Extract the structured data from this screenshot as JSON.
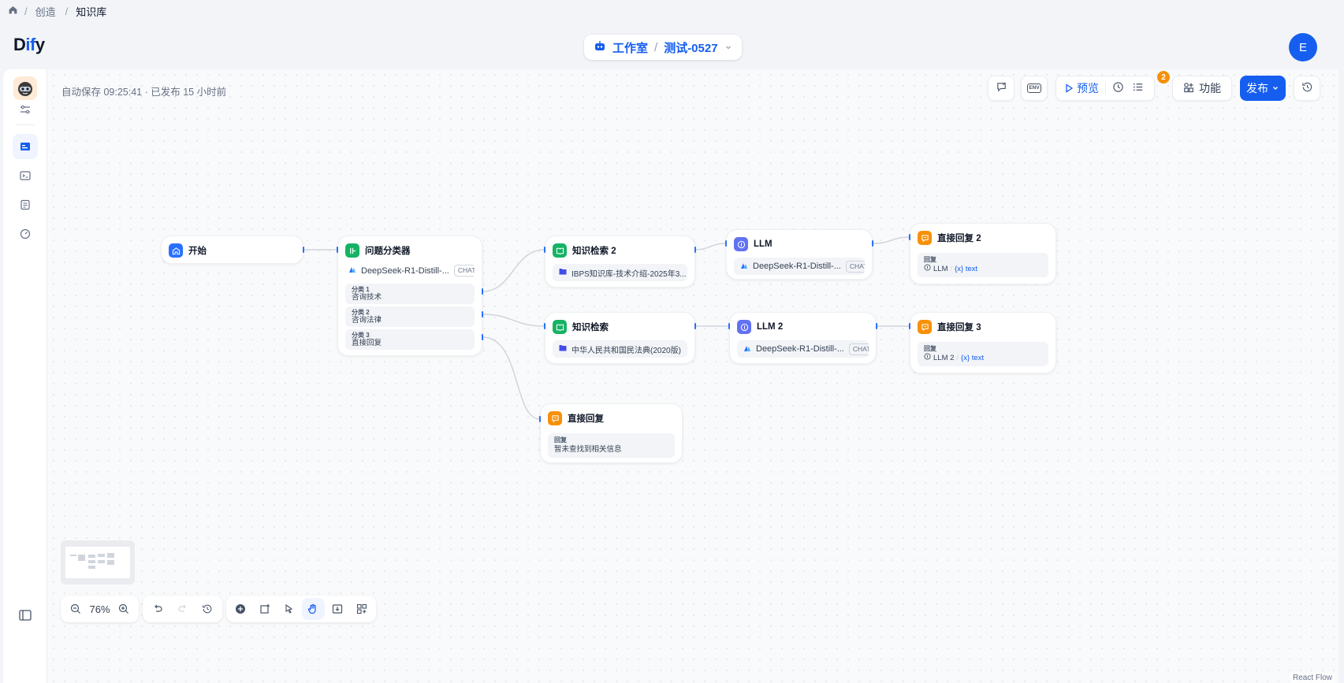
{
  "breadcrumb": {
    "items": [
      "创造",
      "知识库"
    ]
  },
  "header": {
    "logo_left": "D",
    "logo_mid": "if",
    "logo_right": "y",
    "app_type": "工作室",
    "app_name": "测试-0527",
    "avatar_letter": "E"
  },
  "status": {
    "autosave": "自动保存 09:25:41 · 已发布 15 小时前"
  },
  "toolbar": {
    "env_label": "ENV",
    "preview_label": "预览",
    "badge_count": "2",
    "features_label": "功能",
    "publish_label": "发布"
  },
  "nodes": {
    "start": {
      "title": "开始"
    },
    "classifier": {
      "title": "问题分类器",
      "model": "DeepSeek-R1-Distill-...",
      "model_tag": "CHAT",
      "classes": [
        {
          "label": "分类 1",
          "value": "咨询技术"
        },
        {
          "label": "分类 2",
          "value": "咨询法律"
        },
        {
          "label": "分类 3",
          "value": "直接回复"
        }
      ]
    },
    "kr2": {
      "title": "知识检索 2",
      "dataset": "IBPS知识库-技术介绍-2025年3..."
    },
    "kr": {
      "title": "知识检索",
      "dataset": "中华人民共和国民法典(2020版)"
    },
    "llm": {
      "title": "LLM",
      "model": "DeepSeek-R1-Distill-...",
      "model_tag": "CHAT"
    },
    "llm2": {
      "title": "LLM 2",
      "model": "DeepSeek-R1-Distill-...",
      "model_tag": "CHAT"
    },
    "ans2": {
      "title": "直接回复 2",
      "reply_label": "回复",
      "ref_node": "LLM",
      "ref_var": "{x} text"
    },
    "ans3": {
      "title": "直接回复 3",
      "reply_label": "回复",
      "ref_node": "LLM 2",
      "ref_var": "{x} text"
    },
    "ans": {
      "title": "直接回复",
      "reply_label": "回复",
      "reply_text": "暂未查找到相关信息"
    }
  },
  "zoom": {
    "level": "76%"
  },
  "footer": {
    "attribution": "React Flow"
  },
  "colors": {
    "accent": "#155eef",
    "start": "#2970ff",
    "classifier": "#16b364",
    "knowledge": "#16b364",
    "llm": "#6172f3",
    "answer": "#f79009"
  }
}
